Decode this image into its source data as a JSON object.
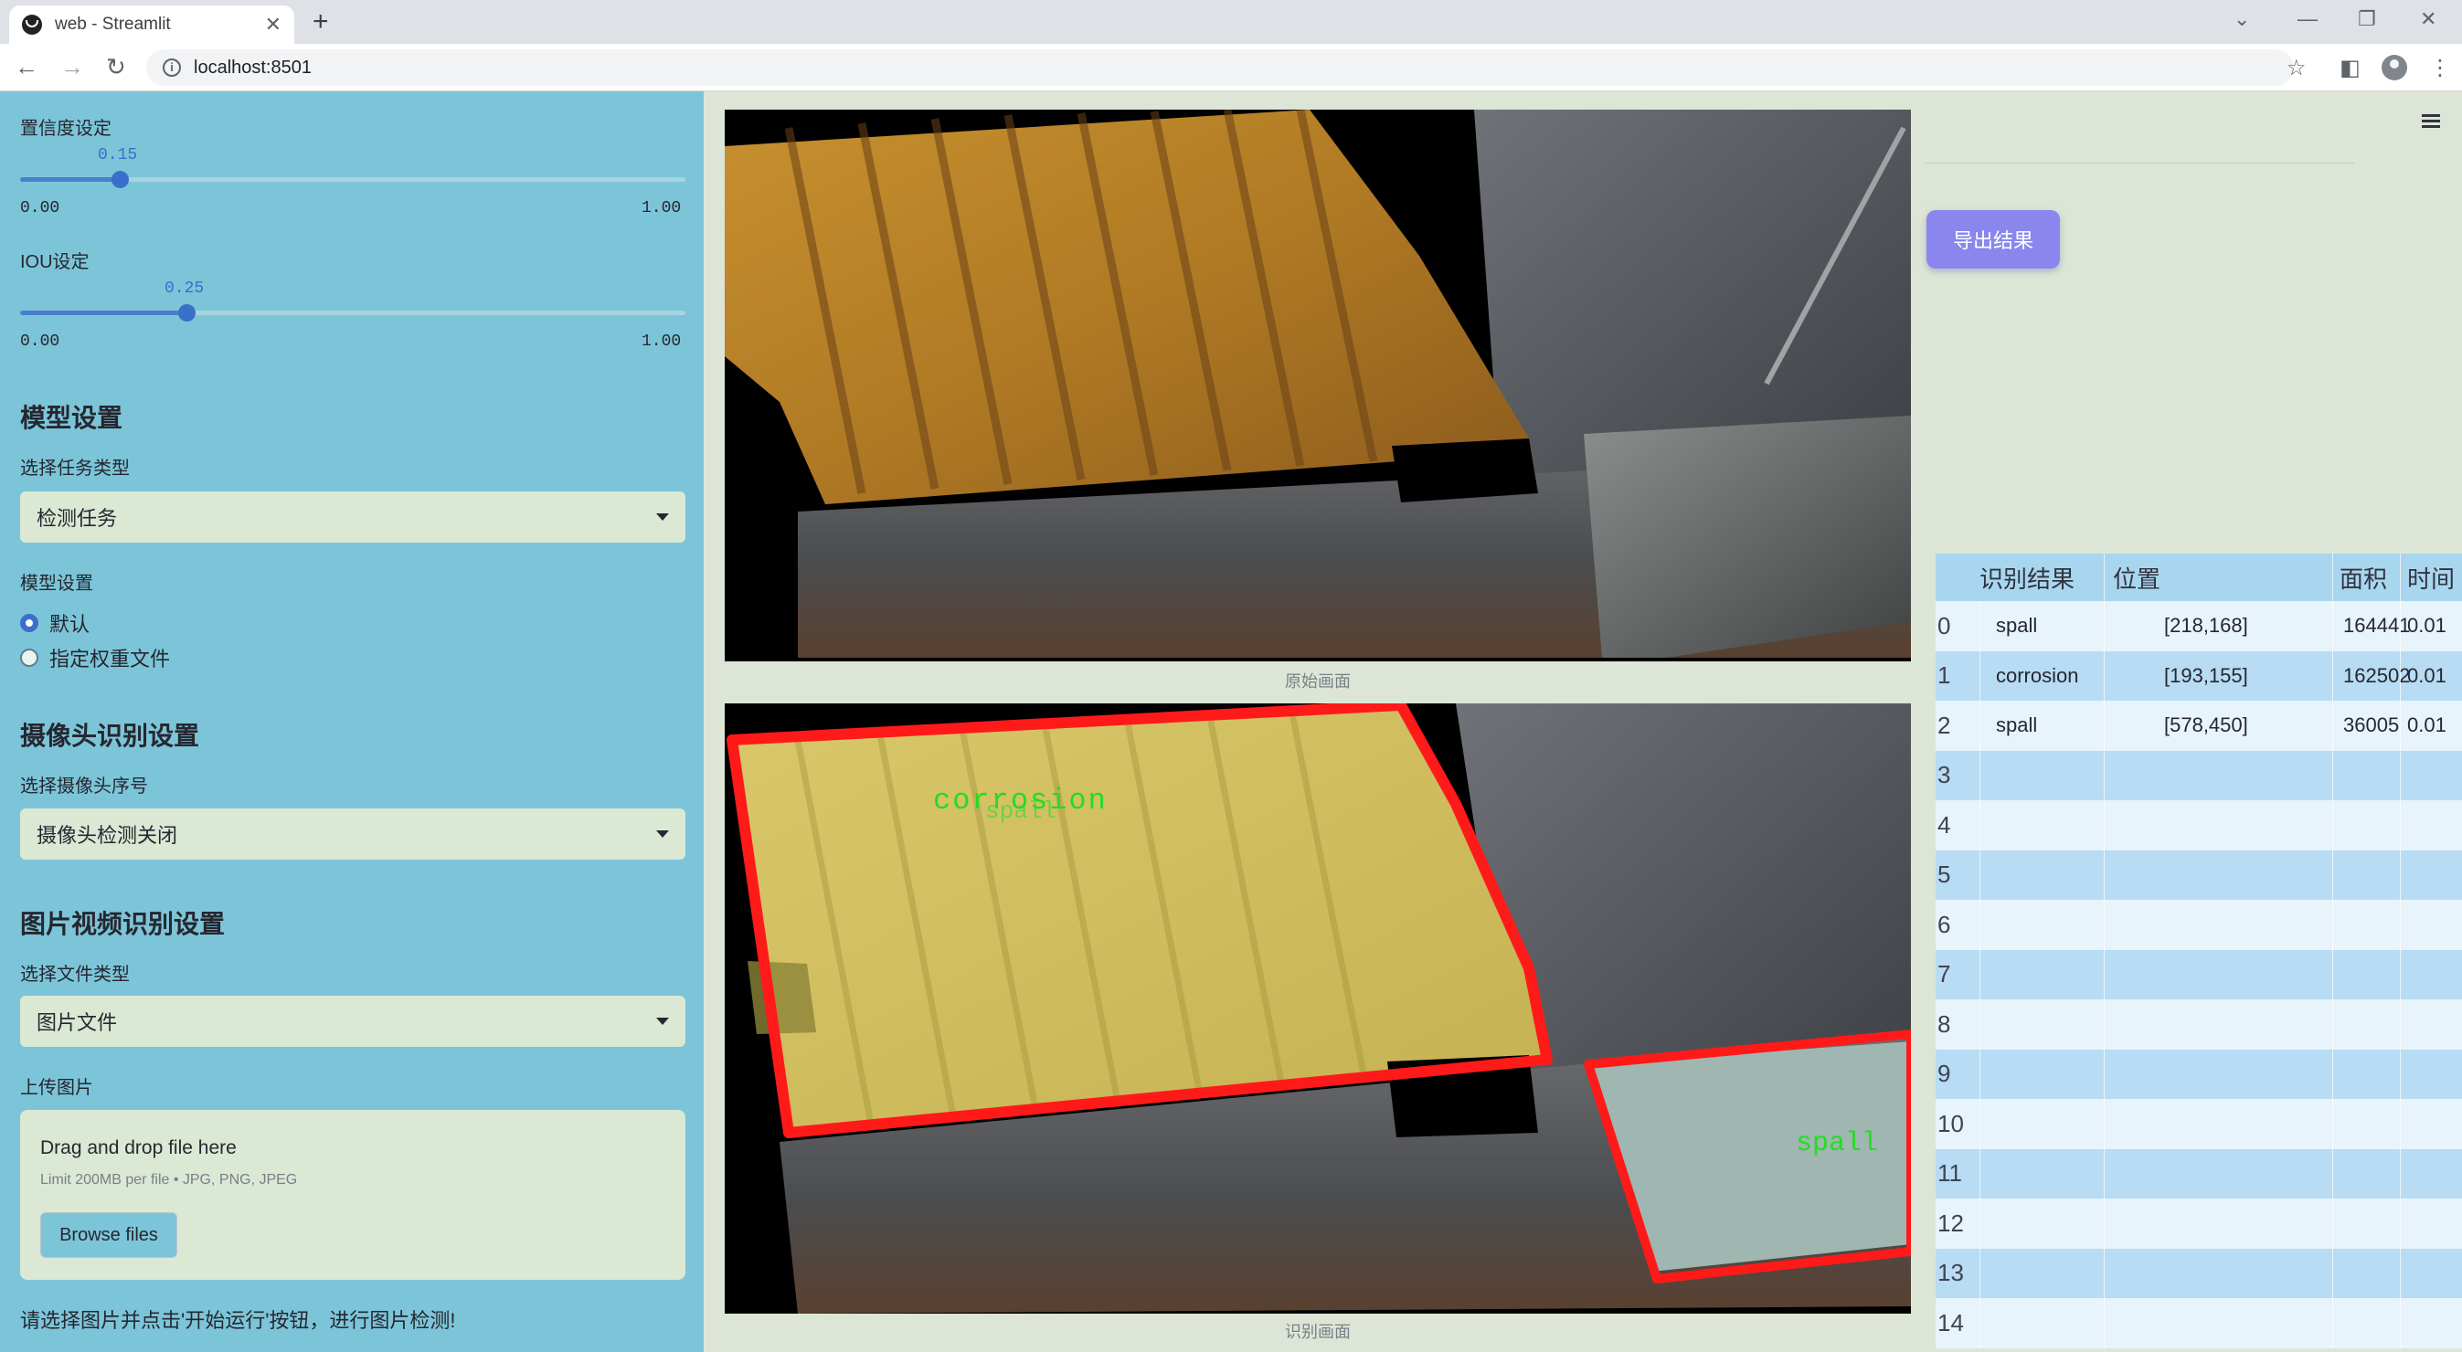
{
  "browser": {
    "tab_title": "web - Streamlit",
    "tab_close": "✕",
    "new_tab": "+",
    "url": "localhost:8501",
    "info_glyph": "i",
    "nav": {
      "back": "←",
      "forward": "→",
      "reload": "↻"
    },
    "window_controls": {
      "dropdown": "⌄",
      "minimize": "—",
      "restore": "❐",
      "close": "✕"
    },
    "toolbar_icons": {
      "star": "☆",
      "sidebar": "◧",
      "menu": "⋮"
    }
  },
  "sidebar": {
    "confidence": {
      "label": "置信度设定",
      "value": "0.15",
      "min": "0.00",
      "max": "1.00",
      "fraction": 0.15
    },
    "iou": {
      "label": "IOU设定",
      "value": "0.25",
      "min": "0.00",
      "max": "1.00",
      "fraction": 0.25
    },
    "model_section": {
      "heading": "模型设置",
      "task_label": "选择任务类型",
      "task_value": "检测任务",
      "model_label": "模型设置",
      "options": [
        "默认",
        "指定权重文件"
      ],
      "selected_option": "默认"
    },
    "camera_section": {
      "heading": "摄像头识别设置",
      "camera_label": "选择摄像头序号",
      "camera_value": "摄像头检测关闭"
    },
    "media_section": {
      "heading": "图片视频识别设置",
      "file_type_label": "选择文件类型",
      "file_type_value": "图片文件",
      "upload_label": "上传图片",
      "drop_text": "Drag and drop file here",
      "limit_text": "Limit 200MB per file • JPG, PNG, JPEG",
      "browse_label": "Browse files"
    },
    "footer_hint": "请选择图片并点击'开始运行'按钮，进行图片检测!"
  },
  "main": {
    "original_caption": "原始画面",
    "result_caption": "识别画面",
    "detection_labels": [
      "corrosion",
      "spall",
      "spall"
    ],
    "colors": {
      "box": "#ff1a1a",
      "label": "#22dd22",
      "accent": "#3a6fc9",
      "export": "#8a86ee"
    }
  },
  "right": {
    "export_label": "导出结果",
    "table": {
      "headers": [
        "识别结果",
        "位置",
        "面积",
        "时间"
      ],
      "rows": [
        {
          "idx": "0",
          "result": "spall",
          "position": "[218,168]",
          "area": "164441",
          "time": "0.01"
        },
        {
          "idx": "1",
          "result": "corrosion",
          "position": "[193,155]",
          "area": "162502",
          "time": "0.01"
        },
        {
          "idx": "2",
          "result": "spall",
          "position": "[578,450]",
          "area": "36005",
          "time": "0.01"
        },
        {
          "idx": "3",
          "result": "",
          "position": "",
          "area": "",
          "time": ""
        },
        {
          "idx": "4",
          "result": "",
          "position": "",
          "area": "",
          "time": ""
        },
        {
          "idx": "5",
          "result": "",
          "position": "",
          "area": "",
          "time": ""
        },
        {
          "idx": "6",
          "result": "",
          "position": "",
          "area": "",
          "time": ""
        },
        {
          "idx": "7",
          "result": "",
          "position": "",
          "area": "",
          "time": ""
        },
        {
          "idx": "8",
          "result": "",
          "position": "",
          "area": "",
          "time": ""
        },
        {
          "idx": "9",
          "result": "",
          "position": "",
          "area": "",
          "time": ""
        },
        {
          "idx": "10",
          "result": "",
          "position": "",
          "area": "",
          "time": ""
        },
        {
          "idx": "11",
          "result": "",
          "position": "",
          "area": "",
          "time": ""
        },
        {
          "idx": "12",
          "result": "",
          "position": "",
          "area": "",
          "time": ""
        },
        {
          "idx": "13",
          "result": "",
          "position": "",
          "area": "",
          "time": ""
        },
        {
          "idx": "14",
          "result": "",
          "position": "",
          "area": "",
          "time": ""
        }
      ]
    }
  }
}
